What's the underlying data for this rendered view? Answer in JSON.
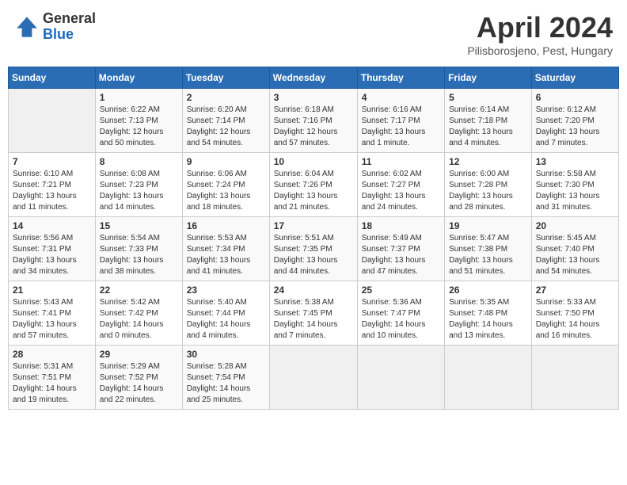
{
  "logo": {
    "general": "General",
    "blue": "Blue"
  },
  "header": {
    "title": "April 2024",
    "subtitle": "Pilisborosjeno, Pest, Hungary"
  },
  "weekdays": [
    "Sunday",
    "Monday",
    "Tuesday",
    "Wednesday",
    "Thursday",
    "Friday",
    "Saturday"
  ],
  "weeks": [
    [
      {
        "day": "",
        "info": ""
      },
      {
        "day": "1",
        "info": "Sunrise: 6:22 AM\nSunset: 7:13 PM\nDaylight: 12 hours\nand 50 minutes."
      },
      {
        "day": "2",
        "info": "Sunrise: 6:20 AM\nSunset: 7:14 PM\nDaylight: 12 hours\nand 54 minutes."
      },
      {
        "day": "3",
        "info": "Sunrise: 6:18 AM\nSunset: 7:16 PM\nDaylight: 12 hours\nand 57 minutes."
      },
      {
        "day": "4",
        "info": "Sunrise: 6:16 AM\nSunset: 7:17 PM\nDaylight: 13 hours\nand 1 minute."
      },
      {
        "day": "5",
        "info": "Sunrise: 6:14 AM\nSunset: 7:18 PM\nDaylight: 13 hours\nand 4 minutes."
      },
      {
        "day": "6",
        "info": "Sunrise: 6:12 AM\nSunset: 7:20 PM\nDaylight: 13 hours\nand 7 minutes."
      }
    ],
    [
      {
        "day": "7",
        "info": "Sunrise: 6:10 AM\nSunset: 7:21 PM\nDaylight: 13 hours\nand 11 minutes."
      },
      {
        "day": "8",
        "info": "Sunrise: 6:08 AM\nSunset: 7:23 PM\nDaylight: 13 hours\nand 14 minutes."
      },
      {
        "day": "9",
        "info": "Sunrise: 6:06 AM\nSunset: 7:24 PM\nDaylight: 13 hours\nand 18 minutes."
      },
      {
        "day": "10",
        "info": "Sunrise: 6:04 AM\nSunset: 7:26 PM\nDaylight: 13 hours\nand 21 minutes."
      },
      {
        "day": "11",
        "info": "Sunrise: 6:02 AM\nSunset: 7:27 PM\nDaylight: 13 hours\nand 24 minutes."
      },
      {
        "day": "12",
        "info": "Sunrise: 6:00 AM\nSunset: 7:28 PM\nDaylight: 13 hours\nand 28 minutes."
      },
      {
        "day": "13",
        "info": "Sunrise: 5:58 AM\nSunset: 7:30 PM\nDaylight: 13 hours\nand 31 minutes."
      }
    ],
    [
      {
        "day": "14",
        "info": "Sunrise: 5:56 AM\nSunset: 7:31 PM\nDaylight: 13 hours\nand 34 minutes."
      },
      {
        "day": "15",
        "info": "Sunrise: 5:54 AM\nSunset: 7:33 PM\nDaylight: 13 hours\nand 38 minutes."
      },
      {
        "day": "16",
        "info": "Sunrise: 5:53 AM\nSunset: 7:34 PM\nDaylight: 13 hours\nand 41 minutes."
      },
      {
        "day": "17",
        "info": "Sunrise: 5:51 AM\nSunset: 7:35 PM\nDaylight: 13 hours\nand 44 minutes."
      },
      {
        "day": "18",
        "info": "Sunrise: 5:49 AM\nSunset: 7:37 PM\nDaylight: 13 hours\nand 47 minutes."
      },
      {
        "day": "19",
        "info": "Sunrise: 5:47 AM\nSunset: 7:38 PM\nDaylight: 13 hours\nand 51 minutes."
      },
      {
        "day": "20",
        "info": "Sunrise: 5:45 AM\nSunset: 7:40 PM\nDaylight: 13 hours\nand 54 minutes."
      }
    ],
    [
      {
        "day": "21",
        "info": "Sunrise: 5:43 AM\nSunset: 7:41 PM\nDaylight: 13 hours\nand 57 minutes."
      },
      {
        "day": "22",
        "info": "Sunrise: 5:42 AM\nSunset: 7:42 PM\nDaylight: 14 hours\nand 0 minutes."
      },
      {
        "day": "23",
        "info": "Sunrise: 5:40 AM\nSunset: 7:44 PM\nDaylight: 14 hours\nand 4 minutes."
      },
      {
        "day": "24",
        "info": "Sunrise: 5:38 AM\nSunset: 7:45 PM\nDaylight: 14 hours\nand 7 minutes."
      },
      {
        "day": "25",
        "info": "Sunrise: 5:36 AM\nSunset: 7:47 PM\nDaylight: 14 hours\nand 10 minutes."
      },
      {
        "day": "26",
        "info": "Sunrise: 5:35 AM\nSunset: 7:48 PM\nDaylight: 14 hours\nand 13 minutes."
      },
      {
        "day": "27",
        "info": "Sunrise: 5:33 AM\nSunset: 7:50 PM\nDaylight: 14 hours\nand 16 minutes."
      }
    ],
    [
      {
        "day": "28",
        "info": "Sunrise: 5:31 AM\nSunset: 7:51 PM\nDaylight: 14 hours\nand 19 minutes."
      },
      {
        "day": "29",
        "info": "Sunrise: 5:29 AM\nSunset: 7:52 PM\nDaylight: 14 hours\nand 22 minutes."
      },
      {
        "day": "30",
        "info": "Sunrise: 5:28 AM\nSunset: 7:54 PM\nDaylight: 14 hours\nand 25 minutes."
      },
      {
        "day": "",
        "info": ""
      },
      {
        "day": "",
        "info": ""
      },
      {
        "day": "",
        "info": ""
      },
      {
        "day": "",
        "info": ""
      }
    ]
  ]
}
